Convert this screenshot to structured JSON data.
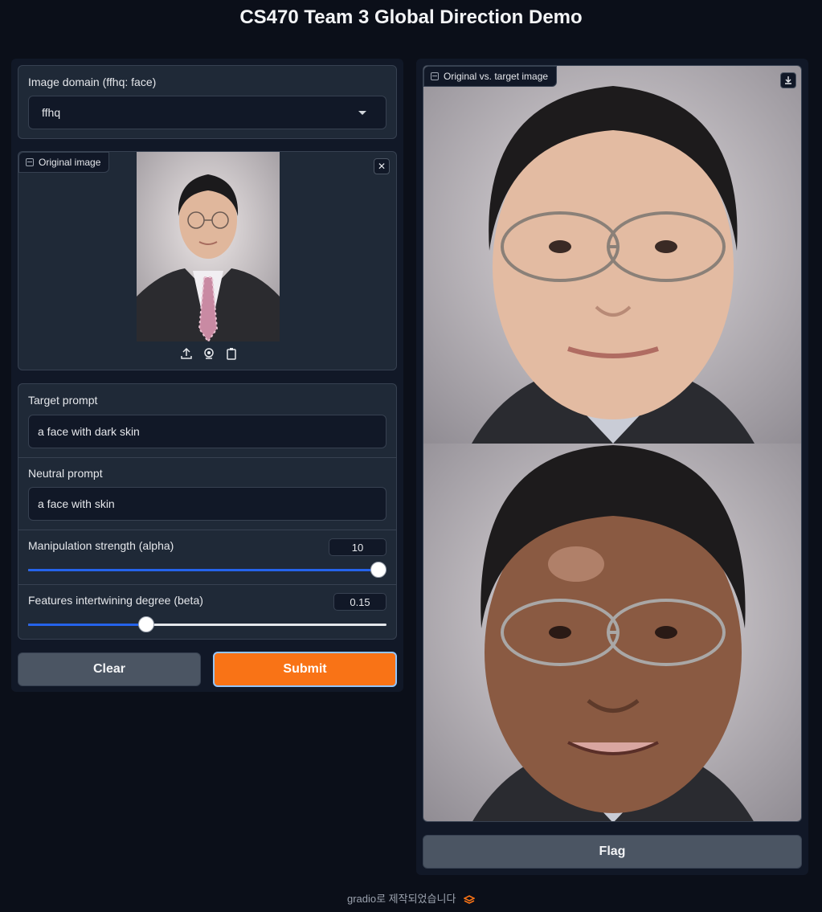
{
  "title": "CS470 Team 3 Global Direction Demo",
  "domain": {
    "label": "Image domain (ffhq: face)",
    "value": "ffhq"
  },
  "original_image": {
    "label": "Original image"
  },
  "target_prompt": {
    "label": "Target prompt",
    "value": "a face with dark skin"
  },
  "neutral_prompt": {
    "label": "Neutral prompt",
    "value": "a face with skin"
  },
  "alpha": {
    "label": "Manipulation strength (alpha)",
    "value": "10",
    "fraction": 1.0
  },
  "beta": {
    "label": "Features intertwining degree (beta)",
    "value": "0.15",
    "fraction": 0.33
  },
  "buttons": {
    "clear": "Clear",
    "submit": "Submit",
    "flag": "Flag"
  },
  "output": {
    "label": "Original vs. target image"
  },
  "footer": {
    "text": "gradio로 제작되었습니다"
  },
  "colors": {
    "accent": "#f97316",
    "slider": "#2563eb",
    "background": "#0b0f19"
  }
}
